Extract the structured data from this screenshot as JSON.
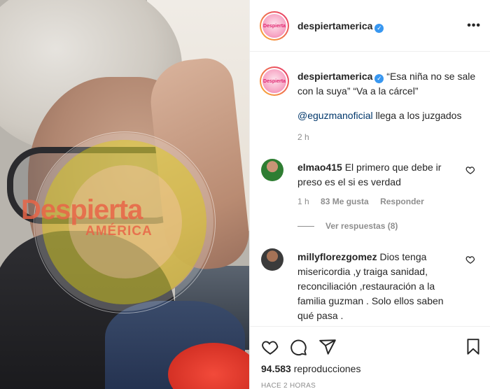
{
  "post": {
    "account": "despiertamerica",
    "avatar_text": "Despierta",
    "caption_text": "“Esa niña no se sale con la suya” “Va a la cárcel”",
    "caption_mention": "@eguzmanoficial",
    "caption_mention_suffix": " llega a los juzgados",
    "caption_time": "2 h",
    "views_count": "94.583",
    "views_label": " reproducciones",
    "posted_ago": "HACE 2 HORAS"
  },
  "watermark": {
    "line1": "Despierta",
    "line2": "AMÉRICA"
  },
  "comments": [
    {
      "user": "elmao415",
      "text": "El primero que debe ir preso es el si es verdad",
      "time": "1 h",
      "likes": "83 Me gusta",
      "reply": "Responder",
      "view_replies": "Ver respuestas (8)"
    },
    {
      "user": "millyflorezgomez",
      "text": "Dios tenga misericordia ,y traiga sanidad, reconciliación ,restauración a la familia guzman . Solo ellos saben qué pasa ."
    }
  ],
  "icons": {
    "verified": "verified-badge-icon",
    "more": "more-options-icon",
    "like": "heart-icon",
    "comment": "comment-bubble-icon",
    "share": "paper-plane-icon",
    "save": "bookmark-icon"
  },
  "colors": {
    "verified": "#3897f0",
    "mention": "#00376b",
    "secondary_text": "#8e8e8e",
    "primary_text": "#262626"
  }
}
